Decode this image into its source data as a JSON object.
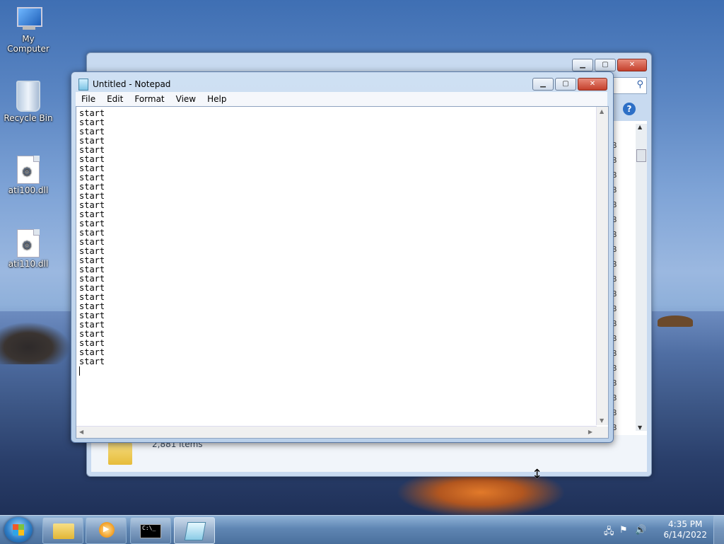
{
  "desktop": {
    "icons": [
      {
        "label": "My Computer"
      },
      {
        "label": "Recycle Bin"
      },
      {
        "label": "ati100.dll"
      },
      {
        "label": "ati110.dll"
      }
    ]
  },
  "explorer": {
    "status_count": "2,881 items",
    "size_column_glyph": "B",
    "help_symbol": "?"
  },
  "notepad": {
    "title": "Untitled - Notepad",
    "menu": [
      "File",
      "Edit",
      "Format",
      "View",
      "Help"
    ],
    "content": "start\nstart\nstart\nstart\nstart\nstart\nstart\nstart\nstart\nstart\nstart\nstart\nstart\nstart\nstart\nstart\nstart\nstart\nstart\nstart\nstart\nstart\nstart\nstart\nstart\nstart\nstart\nstart"
  },
  "taskbar": {
    "clock_time": "4:35 PM",
    "clock_date": "6/14/2022",
    "cmd_glyph": "C:\\_"
  },
  "colors": {
    "taskbar": "#5f86b3",
    "window_frame": "#b9d0ea",
    "close_button": "#c4402c"
  }
}
